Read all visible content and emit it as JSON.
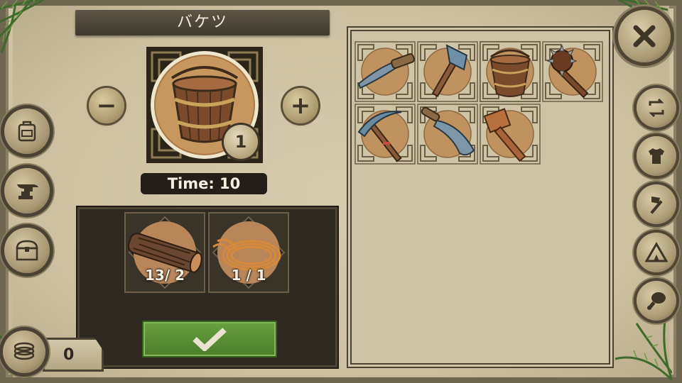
{
  "title": "バケツ",
  "selected_item": {
    "name": "bucket",
    "quantity": "1"
  },
  "time_label": "Time: 10",
  "quantity_controls": {
    "minus": "−",
    "plus": "+"
  },
  "ingredients": [
    {
      "name": "log",
      "count": "13/ 2"
    },
    {
      "name": "rope",
      "count": "1 / 1"
    }
  ],
  "confirm_icon": "checkmark-icon",
  "recipes": [
    {
      "name": "stone-knife",
      "icon": "knife-icon"
    },
    {
      "name": "stone-axe",
      "icon": "axe-icon"
    },
    {
      "name": "bucket",
      "icon": "bucket-icon",
      "selected": true
    },
    {
      "name": "spiked-club",
      "icon": "mace-icon"
    },
    {
      "name": "pickaxe",
      "icon": "pickaxe-icon"
    },
    {
      "name": "machete",
      "icon": "machete-icon"
    },
    {
      "name": "wooden-mallet",
      "icon": "mallet-icon"
    }
  ],
  "left_nav": [
    {
      "name": "backpack",
      "icon": "backpack-icon"
    },
    {
      "name": "anvil",
      "icon": "anvil-icon"
    },
    {
      "name": "chest",
      "icon": "chest-icon"
    }
  ],
  "right_nav": [
    {
      "name": "swap",
      "icon": "swap-icon"
    },
    {
      "name": "armor",
      "icon": "armor-icon"
    },
    {
      "name": "tools",
      "icon": "hammer-icon"
    },
    {
      "name": "camp",
      "icon": "tent-icon"
    },
    {
      "name": "food",
      "icon": "meat-icon"
    }
  ],
  "currency": {
    "icon": "coins-icon",
    "value": "0"
  },
  "colors": {
    "paper": "#cdc2a3",
    "dark_panel": "#2f2a21",
    "confirm_green": "#5a8e35",
    "title_bar": "#4c4538"
  }
}
